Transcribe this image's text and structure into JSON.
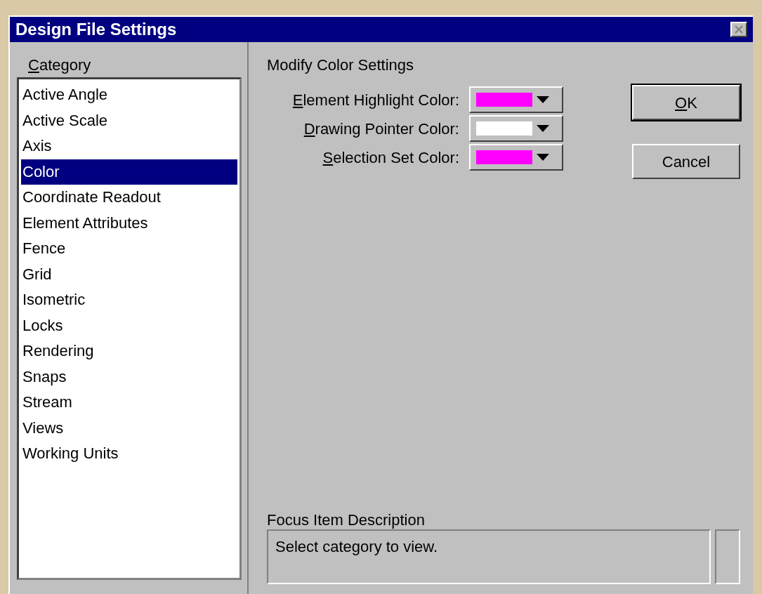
{
  "window": {
    "title": "Design File Settings",
    "close_disabled": true
  },
  "category": {
    "label": "Category",
    "mnemonic": true,
    "items": [
      {
        "label": "Active Angle",
        "selected": false
      },
      {
        "label": "Active Scale",
        "selected": false
      },
      {
        "label": "Axis",
        "selected": false
      },
      {
        "label": "Color",
        "selected": true
      },
      {
        "label": "Coordinate Readout",
        "selected": false
      },
      {
        "label": "Element Attributes",
        "selected": false
      },
      {
        "label": "Fence",
        "selected": false
      },
      {
        "label": "Grid",
        "selected": false
      },
      {
        "label": "Isometric",
        "selected": false
      },
      {
        "label": "Locks",
        "selected": false
      },
      {
        "label": "Rendering",
        "selected": false
      },
      {
        "label": "Snaps",
        "selected": false
      },
      {
        "label": "Stream",
        "selected": false
      },
      {
        "label": "Views",
        "selected": false
      },
      {
        "label": "Working Units",
        "selected": false
      }
    ]
  },
  "settings": {
    "title": "Modify Color Settings",
    "rows": [
      {
        "label": "Element Highlight Color:",
        "mnemonic": true,
        "color": "#ff00ff"
      },
      {
        "label": "Drawing Pointer Color:",
        "mnemonic": true,
        "color": "#ffffff"
      },
      {
        "label": "Selection Set Color:",
        "mnemonic": true,
        "color": "#ff00ff"
      }
    ]
  },
  "buttons": [
    {
      "label": "OK",
      "mnemonic": true,
      "default": true
    },
    {
      "label": "Cancel",
      "mnemonic": false,
      "default": false
    }
  ],
  "focus": {
    "label": "Focus Item Description",
    "text": "Select category to view."
  }
}
